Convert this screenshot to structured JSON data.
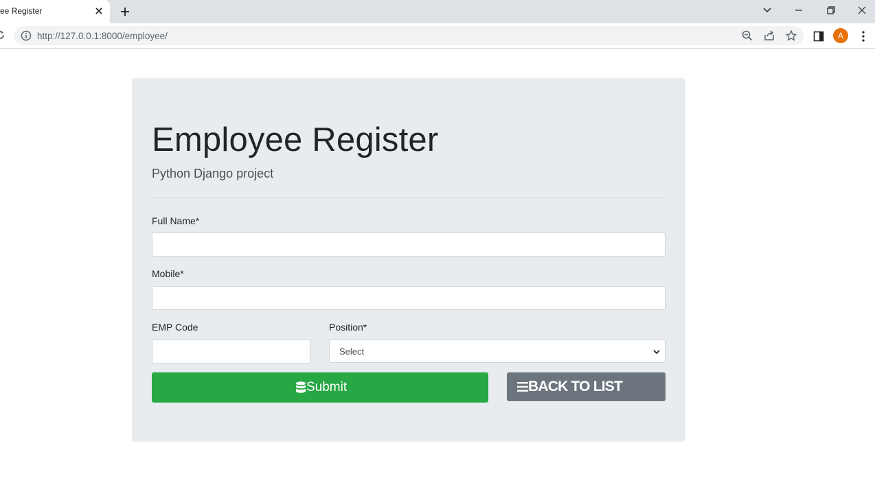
{
  "browser": {
    "tab_title": "ee Register",
    "url": "http://127.0.0.1:8000/employee/",
    "avatar_letter": "A",
    "avatar_color": "#e8710a"
  },
  "page": {
    "title": "Employee Register",
    "subtitle": "Python Django project"
  },
  "form": {
    "full_name_label": "Full Name*",
    "full_name_value": "",
    "mobile_label": "Mobile*",
    "mobile_value": "",
    "emp_code_label": "EMP Code",
    "emp_code_value": "",
    "position_label": "Position*",
    "position_selected": "Select",
    "submit_label": "Submit",
    "back_label": "BACK TO LIST"
  },
  "colors": {
    "submit": "#28a745",
    "back": "#6c757d",
    "panel": "#e9ecef"
  },
  "icons": {
    "submit": "database-icon",
    "back": "list-icon"
  }
}
